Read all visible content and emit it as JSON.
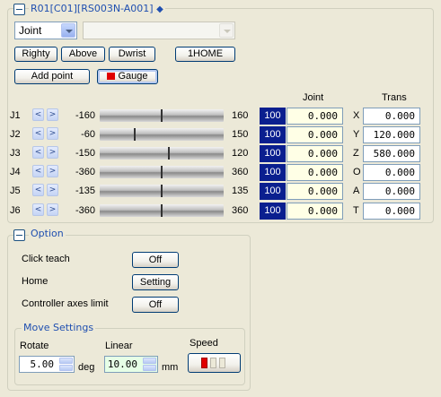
{
  "robot_group": {
    "title": "R01[C01][RS003N-A001]",
    "mode_select": {
      "value": "Joint"
    },
    "secondary_select": {
      "value": ""
    },
    "buttons": {
      "righty": "Righty",
      "above": "Above",
      "dwrist": "Dwrist",
      "home": "1HOME",
      "add_point": "Add point",
      "gauge": "Gauge"
    }
  },
  "table_headers": {
    "joint": "Joint",
    "trans": "Trans"
  },
  "joints": [
    {
      "label": "J1",
      "min": "-160",
      "max": "160",
      "speed": "100",
      "value": "0.000",
      "slider_fraction": 0.5
    },
    {
      "label": "J2",
      "min": "-60",
      "max": "150",
      "speed": "100",
      "value": "0.000",
      "slider_fraction": 0.286
    },
    {
      "label": "J3",
      "min": "-150",
      "max": "120",
      "speed": "100",
      "value": "0.000",
      "slider_fraction": 0.556
    },
    {
      "label": "J4",
      "min": "-360",
      "max": "360",
      "speed": "100",
      "value": "0.000",
      "slider_fraction": 0.5
    },
    {
      "label": "J5",
      "min": "-135",
      "max": "135",
      "speed": "100",
      "value": "0.000",
      "slider_fraction": 0.5
    },
    {
      "label": "J6",
      "min": "-360",
      "max": "360",
      "speed": "100",
      "value": "0.000",
      "slider_fraction": 0.5
    }
  ],
  "trans": [
    {
      "axis": "X",
      "value": "0.000"
    },
    {
      "axis": "Y",
      "value": "120.000"
    },
    {
      "axis": "Z",
      "value": "580.000"
    },
    {
      "axis": "O",
      "value": "0.000"
    },
    {
      "axis": "A",
      "value": "0.000"
    },
    {
      "axis": "T",
      "value": "0.000"
    }
  ],
  "option_group": {
    "title": "Option",
    "click_teach": {
      "label": "Click teach",
      "button": "Off"
    },
    "home": {
      "label": "Home",
      "button": "Setting"
    },
    "controller_axes_limit": {
      "label": "Controller axes limit",
      "button": "Off"
    }
  },
  "move_settings": {
    "title": "Move Settings",
    "rotate": {
      "label": "Rotate",
      "value": "5.00",
      "unit": "deg"
    },
    "linear": {
      "label": "Linear",
      "value": "10.00",
      "unit": "mm"
    },
    "speed": {
      "label": "Speed",
      "level": 1,
      "levels": 3
    }
  },
  "colors": {
    "accent": "#1F4FB0",
    "speed_box": "#0A1F8F",
    "gauge_red": "#E00000"
  }
}
